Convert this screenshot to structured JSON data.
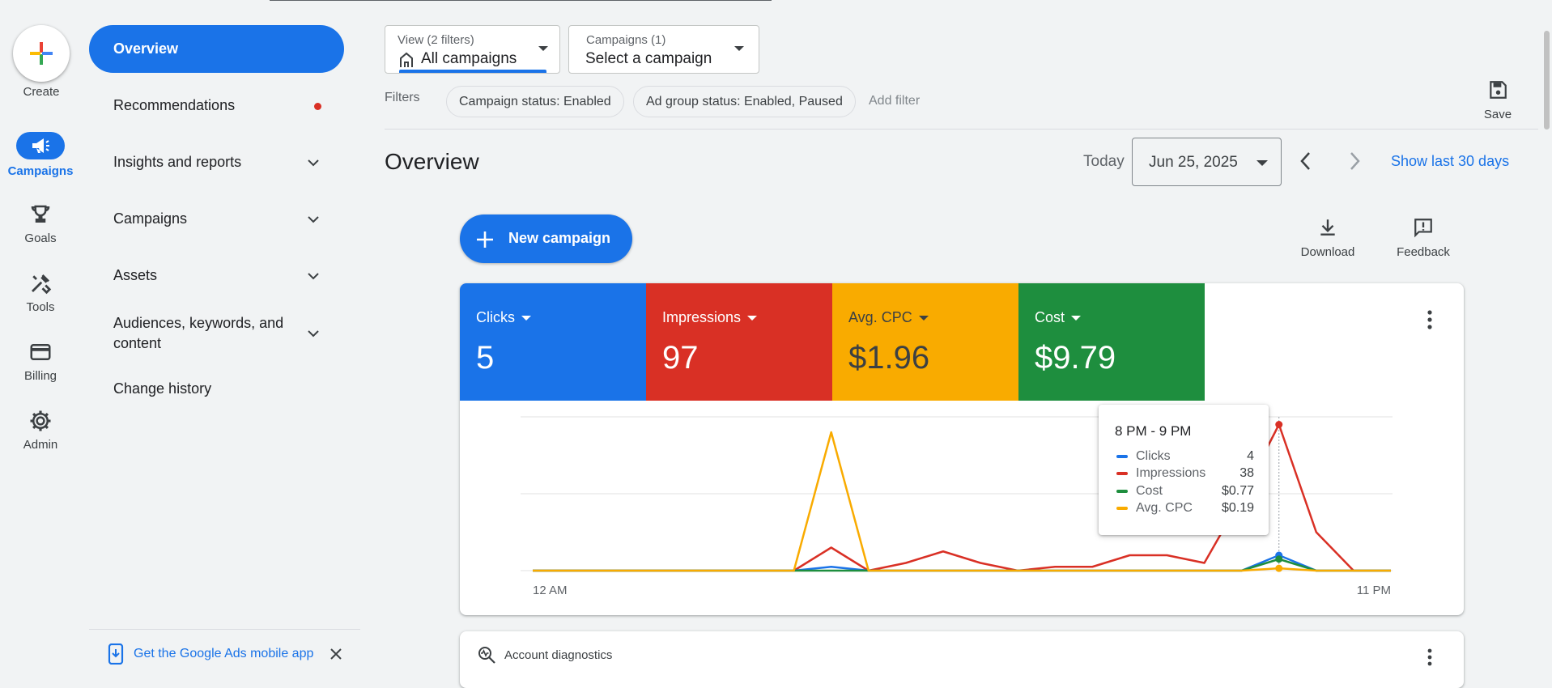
{
  "rail": {
    "create": "Create",
    "items": [
      {
        "label": "Campaigns",
        "icon": "megaphone-icon",
        "active": true
      },
      {
        "label": "Goals",
        "icon": "trophy-icon"
      },
      {
        "label": "Tools",
        "icon": "tools-icon"
      },
      {
        "label": "Billing",
        "icon": "credit-card-icon"
      },
      {
        "label": "Admin",
        "icon": "gear-icon"
      }
    ]
  },
  "nav": {
    "overview": "Overview",
    "recommendations": "Recommendations",
    "insights": "Insights and reports",
    "campaigns": "Campaigns",
    "assets": "Assets",
    "audiences_line1": "Audiences, keywords, and",
    "audiences_line2": "content",
    "change_history": "Change history",
    "mobile_app": "Get the Google Ads mobile app"
  },
  "view_picker": {
    "small": "View (2 filters)",
    "value": "All campaigns"
  },
  "campaign_picker": {
    "small": "Campaigns (1)",
    "value": "Select a campaign"
  },
  "filters": {
    "label": "Filters",
    "chips": [
      "Campaign status: Enabled",
      "Ad group status: Enabled, Paused"
    ],
    "add": "Add filter"
  },
  "save_label": "Save",
  "header": {
    "title": "Overview",
    "today": "Today",
    "date": "Jun 25, 2025",
    "show_last": "Show last 30 days"
  },
  "actions": {
    "new_campaign": "New campaign",
    "download": "Download",
    "feedback": "Feedback"
  },
  "metrics": [
    {
      "label": "Clicks",
      "value": "5",
      "color": "#1a73e8"
    },
    {
      "label": "Impressions",
      "value": "97",
      "color": "#d93025"
    },
    {
      "label": "Avg. CPC",
      "value": "$1.96",
      "color": "#f9ab00"
    },
    {
      "label": "Cost",
      "value": "$9.79",
      "color": "#1e8e3e"
    }
  ],
  "tooltip": {
    "title": "8 PM - 9 PM",
    "rows": [
      {
        "name": "Clicks",
        "value": "4",
        "color": "#1a73e8"
      },
      {
        "name": "Impressions",
        "value": "38",
        "color": "#d93025"
      },
      {
        "name": "Cost",
        "value": "$0.77",
        "color": "#1e8e3e"
      },
      {
        "name": "Avg. CPC",
        "value": "$0.19",
        "color": "#f9ab00"
      }
    ]
  },
  "chart_data": {
    "type": "line",
    "x_start_label": "12 AM",
    "x_end_label": "11 PM",
    "x": [
      0,
      1,
      2,
      3,
      4,
      5,
      6,
      7,
      8,
      9,
      10,
      11,
      12,
      13,
      14,
      15,
      16,
      17,
      18,
      19,
      20,
      21,
      22,
      23
    ],
    "grid": true,
    "ylim": [
      0,
      40
    ],
    "series": [
      {
        "name": "Clicks",
        "color": "#1a73e8",
        "values": [
          0,
          0,
          0,
          0,
          0,
          0,
          0,
          0,
          1,
          0,
          0,
          0,
          0,
          0,
          0,
          0,
          0,
          0,
          0,
          0,
          4,
          0,
          0,
          0
        ]
      },
      {
        "name": "Impressions",
        "color": "#d93025",
        "values": [
          0,
          0,
          0,
          0,
          0,
          0,
          0,
          0,
          6,
          0,
          2,
          5,
          2,
          0,
          1,
          1,
          4,
          4,
          2,
          19,
          38,
          10,
          0,
          0
        ]
      },
      {
        "name": "Cost",
        "color": "#1e8e3e",
        "values": [
          0,
          0,
          0,
          0,
          0,
          0,
          0,
          0,
          0,
          0,
          0,
          0,
          0,
          0,
          0,
          0,
          0,
          0,
          0,
          0,
          3,
          0,
          0,
          0
        ]
      },
      {
        "name": "Avg. CPC",
        "color": "#f9ab00",
        "values": [
          0,
          0,
          0,
          0,
          0,
          0,
          0,
          0,
          36,
          0,
          0,
          0,
          0,
          0,
          0,
          0,
          0,
          0,
          0,
          0,
          0.6,
          0,
          0,
          0
        ]
      }
    ]
  },
  "diagnostics": {
    "label": "Account diagnostics"
  }
}
